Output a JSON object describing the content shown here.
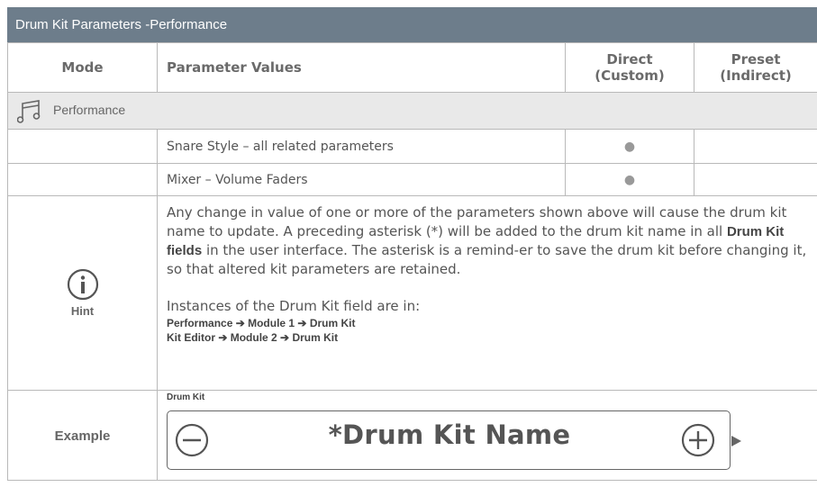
{
  "title": "Drum Kit Parameters -Performance",
  "headers": {
    "mode": "Mode",
    "params": "Parameter Values",
    "direct": "Direct (Custom)",
    "direct_line1": "Direct",
    "direct_line2": "(Custom)",
    "preset": "Preset (Indirect)",
    "preset_line1": "Preset",
    "preset_line2": "(Indirect)"
  },
  "section": {
    "label": "Performance",
    "icon": "music-note-icon"
  },
  "rows": [
    {
      "param": "Snare Style – all related parameters",
      "direct": "●",
      "preset": ""
    },
    {
      "param": "Mixer – Volume Faders",
      "direct": "●",
      "preset": ""
    }
  ],
  "hint": {
    "label": "Hint",
    "icon": "info-circle-icon",
    "text_part1": "Any change in value of one or more of the parameters shown above will cause the drum kit name to update. A preceding asterisk (*) will be added to the drum kit name in all ",
    "text_bold": "Drum Kit fields",
    "text_part2": " in the user interface. The asterisk is a remind-er to save the drum kit before changing it, so that altered kit parameters are retained.",
    "instances_intro": "Instances of the Drum Kit field are in:",
    "paths": [
      "Performance ➔ Module 1 ➔ Drum Kit",
      "Kit Editor ➔ Module 2 ➔ Drum Kit"
    ]
  },
  "example": {
    "label": "Example",
    "field_caption": "Drum Kit",
    "field_value": "*Drum Kit Name",
    "icons": [
      "minus-circle-icon",
      "plus-circle-icon",
      "play-arrow-icon"
    ]
  }
}
